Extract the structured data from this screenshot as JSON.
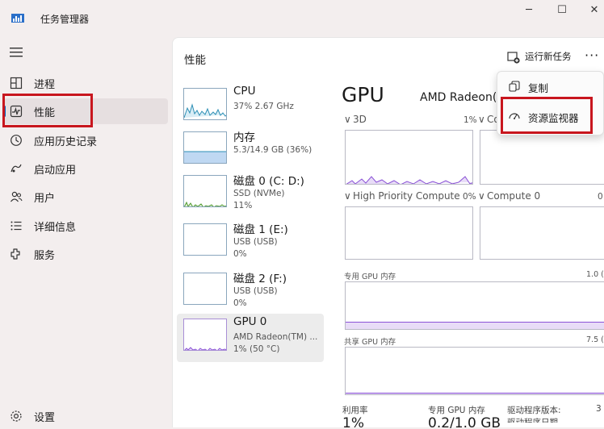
{
  "app": {
    "title": "任务管理器",
    "icon": "task-manager-icon"
  },
  "window_controls": {
    "minimize": "─",
    "maximize": "☐",
    "close": "✕"
  },
  "nav": {
    "items": [
      {
        "label": "进程",
        "icon": "processes-icon"
      },
      {
        "label": "性能",
        "icon": "performance-icon"
      },
      {
        "label": "应用历史记录",
        "icon": "history-icon"
      },
      {
        "label": "启动应用",
        "icon": "startup-icon"
      },
      {
        "label": "用户",
        "icon": "users-icon"
      },
      {
        "label": "详细信息",
        "icon": "details-icon"
      },
      {
        "label": "服务",
        "icon": "services-icon"
      }
    ],
    "active_index": 1,
    "settings": {
      "label": "设置",
      "icon": "settings-icon"
    }
  },
  "header": {
    "title": "性能",
    "run_task": "运行新任务",
    "more": "···"
  },
  "devices": [
    {
      "name": "CPU",
      "sub1": "37%  2.67 GHz",
      "sub2": ""
    },
    {
      "name": "内存",
      "sub1": "5.3/14.9 GB (36%)",
      "sub2": ""
    },
    {
      "name": "磁盘 0 (C: D:)",
      "sub1": "SSD (NVMe)",
      "sub2": "11%"
    },
    {
      "name": "磁盘 1 (E:)",
      "sub1": "USB (USB)",
      "sub2": "0%"
    },
    {
      "name": "磁盘 2 (F:)",
      "sub1": "USB (USB)",
      "sub2": "0%"
    },
    {
      "name": "GPU 0",
      "sub1": "AMD Radeon(TM) ...",
      "sub2": "1% (50 °C)"
    }
  ],
  "selected_device_index": 5,
  "gpu": {
    "title": "GPU",
    "model": "AMD Radeon(T",
    "engines": [
      {
        "label": "3D",
        "pct": "1%"
      },
      {
        "label": "Co",
        "pct": ""
      },
      {
        "label": "High Priority Compute",
        "pct": "0%"
      },
      {
        "label": "Compute 0",
        "pct": "0"
      }
    ],
    "dedicated_memory_label": "专用 GPU 内存",
    "dedicated_memory_max": "1.0 (",
    "dedicated_memory_usage": 0.16,
    "shared_memory_label": "共享 GPU 内存",
    "shared_memory_max": "7.5 (",
    "shared_memory_usage": 0.04
  },
  "bottom_stats": [
    {
      "label": "利用率",
      "value": "1%"
    },
    {
      "label": "专用 GPU 内存",
      "value": "0.2/1.0 GB"
    },
    {
      "label": "驱动程序版本:",
      "value": "驱动程序日期"
    },
    {
      "label": "3",
      "value": ""
    }
  ],
  "context_menu": {
    "items": [
      {
        "label": "复制",
        "icon": "copy-icon"
      },
      {
        "label": "资源监视器",
        "icon": "resource-monitor-icon"
      }
    ]
  },
  "colors": {
    "accent": "#0067c0",
    "highlight_box": "#c8161e",
    "gpu_line": "#8a52d6",
    "gpu_fill": "#e8dcf7",
    "cpu_line": "#2d8fb5",
    "memory_fill": "#bfd8f2",
    "disk_line": "#4f9a2f"
  }
}
